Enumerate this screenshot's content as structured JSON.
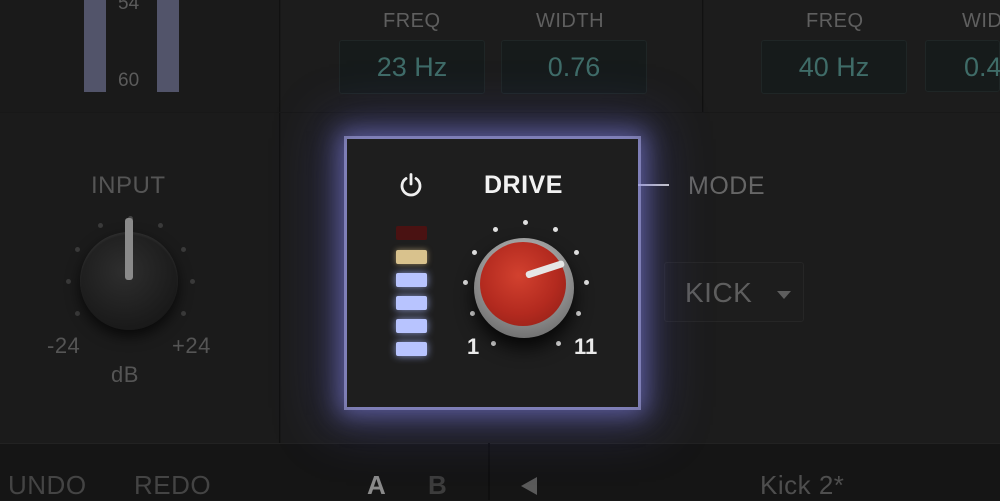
{
  "meters": {
    "top_value": "54",
    "bottom_value": "60"
  },
  "filter_mid": {
    "freq_label": "FREQ",
    "width_label": "WIDTH",
    "freq_value": "23 Hz",
    "width_value": "0.76"
  },
  "filter_right": {
    "freq_label": "FREQ",
    "width_label": "WID",
    "freq_value": "40 Hz",
    "width_value": "0.4"
  },
  "input": {
    "label": "INPUT",
    "min": "-24",
    "max": "+24",
    "unit": "dB"
  },
  "drive": {
    "title": "DRIVE",
    "scale_min": "1",
    "scale_max": "11",
    "led_count": 6
  },
  "mode": {
    "label": "MODE",
    "selected": "KICK"
  },
  "bottom_bar": {
    "undo": "UNDO",
    "redo": "REDO",
    "a": "A",
    "b": "B",
    "preset_name": "Kick 2*"
  },
  "colors": {
    "glow": "#8a8ae0",
    "knob_red": "#c0392b",
    "led_blue": "#b8c4ff",
    "led_amber": "#d9c28d",
    "led_dark_red": "#4a1212"
  },
  "icons": {
    "power": "power-icon",
    "prev": "triangle-left-icon",
    "dropdown": "caret-down-icon"
  }
}
